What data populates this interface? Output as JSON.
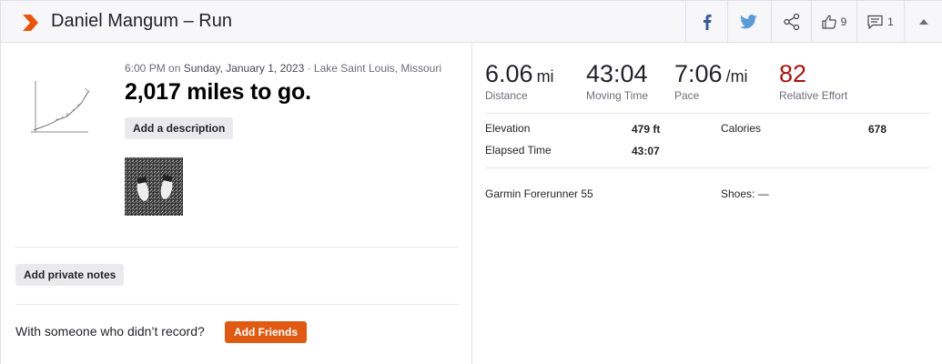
{
  "header": {
    "title": "Daniel Mangum – Run",
    "kudos_count": "9",
    "comment_count": "1"
  },
  "activity": {
    "time": "6:00 PM on ",
    "date": "Sunday, January 1, 2023",
    "location": " · Lake Saint Louis, Missouri",
    "title": "2,017 miles to go.",
    "add_description_label": "Add a description",
    "add_notes_label": "Add private notes",
    "with_someone_text": "With someone who didn’t record?",
    "add_friends_label": "Add Friends"
  },
  "stats": [
    {
      "value": "6.06",
      "unit": "mi",
      "label": "Distance"
    },
    {
      "value": "43:04",
      "unit": "",
      "label": "Moving Time"
    },
    {
      "value": "7:06",
      "unit": "/mi",
      "label": "Pace"
    },
    {
      "value": "82",
      "unit": "",
      "label": "Relative Effort"
    }
  ],
  "details": {
    "elevation_label": "Elevation",
    "elevation_value": "479 ft",
    "calories_label": "Calories",
    "calories_value": "678",
    "elapsed_label": "Elapsed Time",
    "elapsed_value": "43:07",
    "device": "Garmin Forerunner 55",
    "shoes": "Shoes: —"
  },
  "colors": {
    "brand": "#fc4c02",
    "add_friends_bg": "#e05a14",
    "relative_effort": "#a7140f",
    "facebook": "#3b5998",
    "twitter": "#5b9bd5"
  },
  "icons": [
    "strava-chevron-icon",
    "facebook-icon",
    "twitter-icon",
    "share-icon",
    "kudos-thumb-icon",
    "comment-icon",
    "collapse-caret-icon",
    "activity-chart-icon"
  ]
}
